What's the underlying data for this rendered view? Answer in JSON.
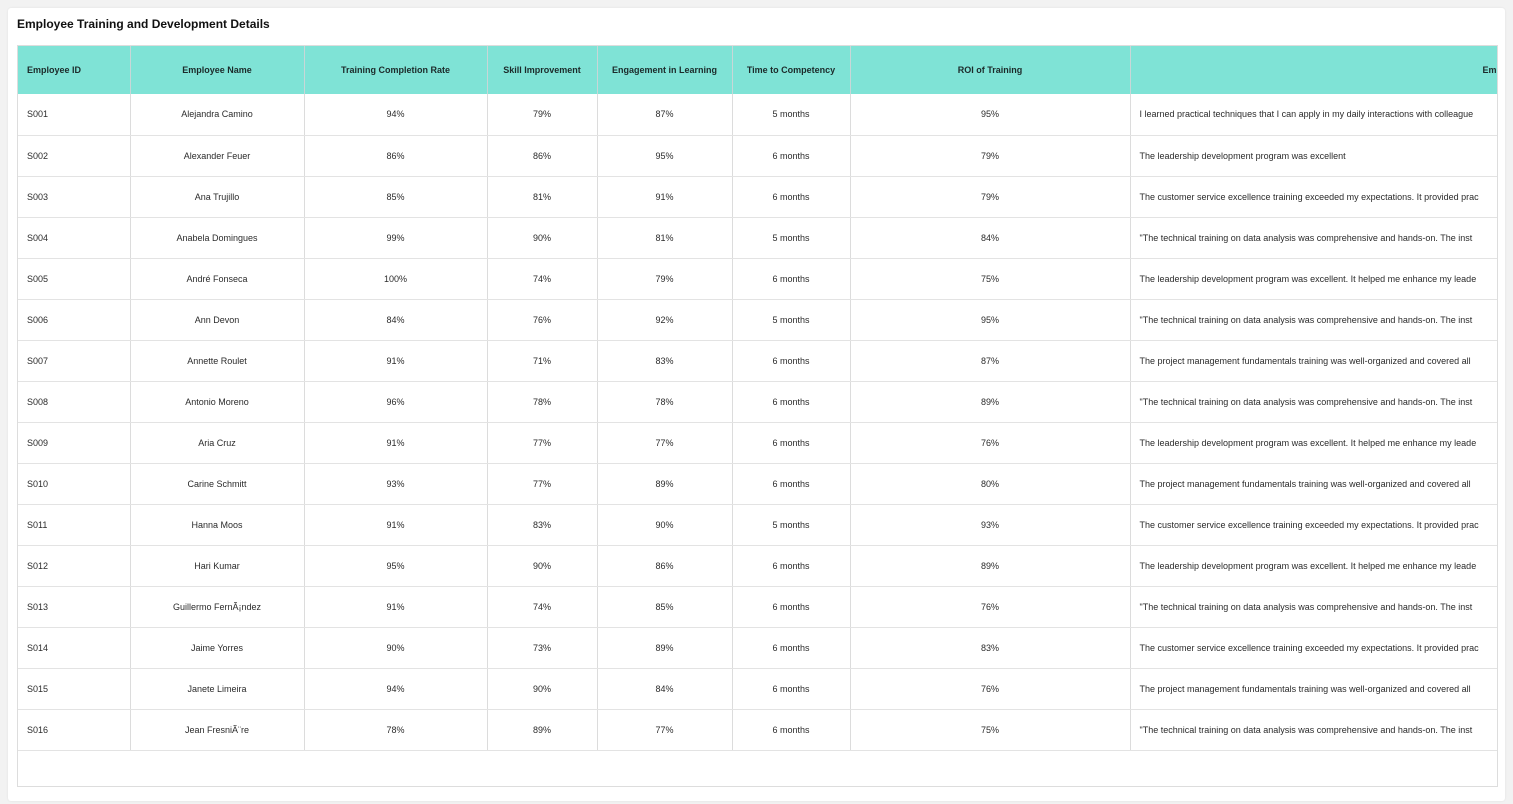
{
  "title": "Employee Training and Development Details",
  "columns": [
    "Employee ID",
    "Employee Name",
    "Training Completion Rate",
    "Skill Improvement",
    "Engagement in Learning",
    "Time to Competency",
    "ROI of Training",
    "Em"
  ],
  "rows": [
    [
      "S001",
      "Alejandra Camino",
      "94%",
      "79%",
      "87%",
      "5 months",
      "95%",
      "I learned practical techniques that I can apply in my daily interactions with colleague"
    ],
    [
      "S002",
      "Alexander Feuer",
      "86%",
      "86%",
      "95%",
      "6 months",
      "79%",
      "The leadership development program was excellent"
    ],
    [
      "S003",
      "Ana Trujillo",
      "85%",
      "81%",
      "91%",
      "6 months",
      "79%",
      "The customer service excellence training exceeded my expectations. It provided prac"
    ],
    [
      "S004",
      "Anabela Domingues",
      "99%",
      "90%",
      "81%",
      "5 months",
      "84%",
      "\"The technical training on data analysis was comprehensive and hands-on. The inst"
    ],
    [
      "S005",
      "André Fonseca",
      "100%",
      "74%",
      "79%",
      "6 months",
      "75%",
      "The leadership development program was excellent. It helped me enhance my leade"
    ],
    [
      "S006",
      "Ann Devon",
      "84%",
      "76%",
      "92%",
      "5 months",
      "95%",
      "\"The technical training on data analysis was comprehensive and hands-on. The inst"
    ],
    [
      "S007",
      "Annette Roulet",
      "91%",
      "71%",
      "83%",
      "6 months",
      "87%",
      "The project management fundamentals training was well-organized and covered all"
    ],
    [
      "S008",
      "Antonio Moreno",
      "96%",
      "78%",
      "78%",
      "6 months",
      "89%",
      "\"The technical training on data analysis was comprehensive and hands-on. The inst"
    ],
    [
      "S009",
      "Aria Cruz",
      "91%",
      "77%",
      "77%",
      "6 months",
      "76%",
      "The leadership development program was excellent. It helped me enhance my leade"
    ],
    [
      "S010",
      "Carine Schmitt",
      "93%",
      "77%",
      "89%",
      "6 months",
      "80%",
      "The project management fundamentals training was well-organized and covered all"
    ],
    [
      "S011",
      "Hanna Moos",
      "91%",
      "83%",
      "90%",
      "5 months",
      "93%",
      "The customer service excellence training exceeded my expectations. It provided prac"
    ],
    [
      "S012",
      "Hari Kumar",
      "95%",
      "90%",
      "86%",
      "6 months",
      "89%",
      "The leadership development program was excellent. It helped me enhance my leade"
    ],
    [
      "S013",
      "Guillermo FernÃ¡ndez",
      "91%",
      "74%",
      "85%",
      "6 months",
      "76%",
      "\"The technical training on data analysis was comprehensive and hands-on. The inst"
    ],
    [
      "S014",
      "Jaime Yorres",
      "90%",
      "73%",
      "89%",
      "6 months",
      "83%",
      "The customer service excellence training exceeded my expectations. It provided prac"
    ],
    [
      "S015",
      "Janete Limeira",
      "94%",
      "90%",
      "84%",
      "6 months",
      "76%",
      "The project management fundamentals training was well-organized and covered all"
    ],
    [
      "S016",
      "Jean FresniÃ¨re",
      "78%",
      "89%",
      "77%",
      "6 months",
      "75%",
      "\"The technical training on data analysis was comprehensive and hands-on. The inst"
    ]
  ],
  "colors": {
    "header_bg": "#7fe3d6",
    "page_bg": "#f2f2f2",
    "card_bg": "#ffffff"
  }
}
